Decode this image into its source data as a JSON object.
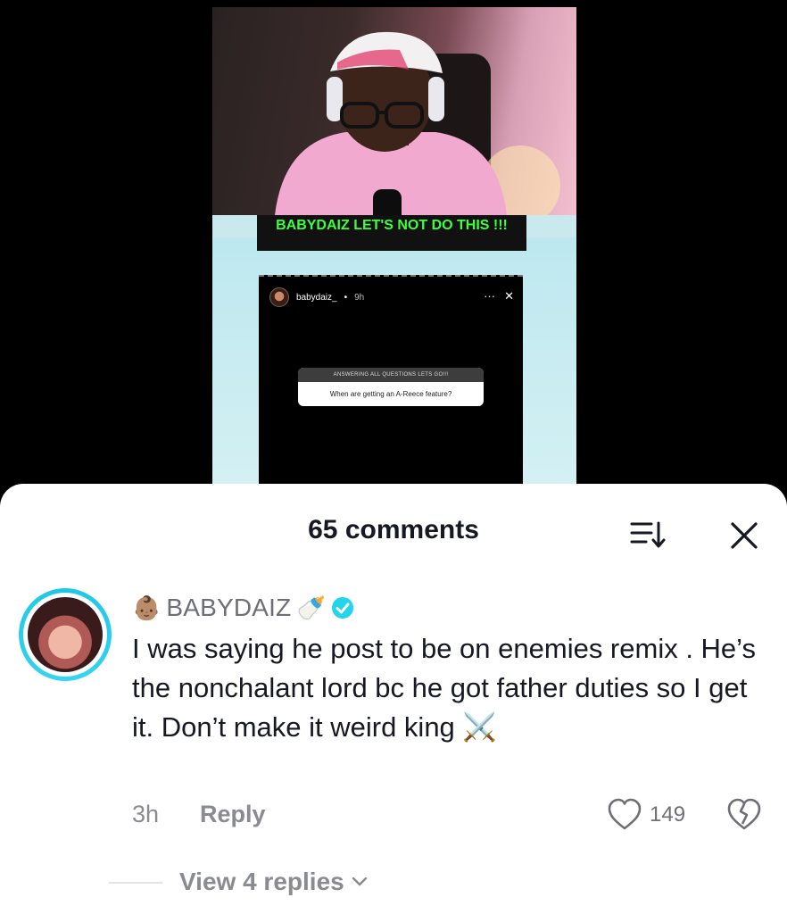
{
  "video": {
    "caption": "BABYDAIZ LET'S NOT DO THIS !!!",
    "story": {
      "username": "babydaiz_",
      "time": "9h",
      "question_header": "ANSWERING ALL QUESTIONS LETS GO!!!",
      "question": "When are getting an A-Reece feature?"
    }
  },
  "comments": {
    "title": "65 comments",
    "sort_icon": "sort-icon",
    "close_icon": "close-icon",
    "items": [
      {
        "username": "BABYDAIZ",
        "prefix_emoji": "👶🏽",
        "suffix_emoji": "🍼",
        "verified": true,
        "text": "I was saying he post to be on enemies remix . He’s the nonchalant lord bc he got father duties so I get it. Don’t make it weird king ⚔️",
        "time": "3h",
        "reply_label": "Reply",
        "likes": "149",
        "view_replies": "View 4 replies"
      }
    ]
  },
  "colors": {
    "caption_green": "#3dff3d",
    "verified_blue": "#20d5ec",
    "text_primary": "#161823",
    "text_secondary": "#8a8b91"
  }
}
